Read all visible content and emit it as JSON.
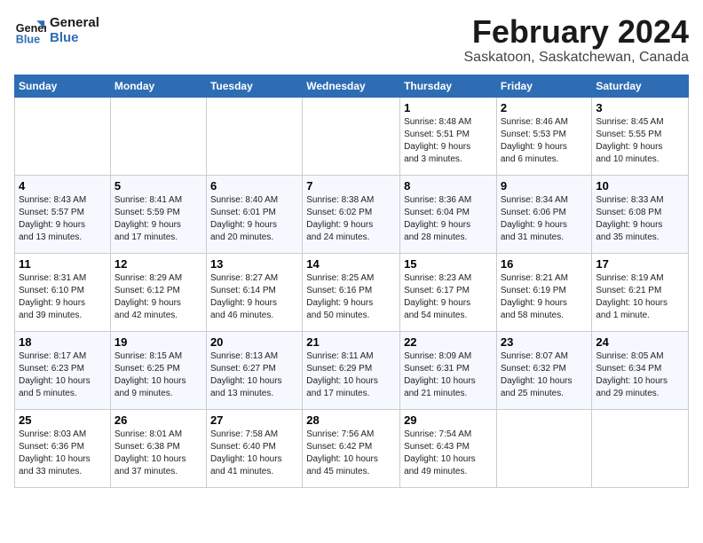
{
  "logo": {
    "line1": "General",
    "line2": "Blue"
  },
  "title": "February 2024",
  "location": "Saskatoon, Saskatchewan, Canada",
  "weekdays": [
    "Sunday",
    "Monday",
    "Tuesday",
    "Wednesday",
    "Thursday",
    "Friday",
    "Saturday"
  ],
  "weeks": [
    [
      {
        "day": "",
        "info": ""
      },
      {
        "day": "",
        "info": ""
      },
      {
        "day": "",
        "info": ""
      },
      {
        "day": "",
        "info": ""
      },
      {
        "day": "1",
        "info": "Sunrise: 8:48 AM\nSunset: 5:51 PM\nDaylight: 9 hours\nand 3 minutes."
      },
      {
        "day": "2",
        "info": "Sunrise: 8:46 AM\nSunset: 5:53 PM\nDaylight: 9 hours\nand 6 minutes."
      },
      {
        "day": "3",
        "info": "Sunrise: 8:45 AM\nSunset: 5:55 PM\nDaylight: 9 hours\nand 10 minutes."
      }
    ],
    [
      {
        "day": "4",
        "info": "Sunrise: 8:43 AM\nSunset: 5:57 PM\nDaylight: 9 hours\nand 13 minutes."
      },
      {
        "day": "5",
        "info": "Sunrise: 8:41 AM\nSunset: 5:59 PM\nDaylight: 9 hours\nand 17 minutes."
      },
      {
        "day": "6",
        "info": "Sunrise: 8:40 AM\nSunset: 6:01 PM\nDaylight: 9 hours\nand 20 minutes."
      },
      {
        "day": "7",
        "info": "Sunrise: 8:38 AM\nSunset: 6:02 PM\nDaylight: 9 hours\nand 24 minutes."
      },
      {
        "day": "8",
        "info": "Sunrise: 8:36 AM\nSunset: 6:04 PM\nDaylight: 9 hours\nand 28 minutes."
      },
      {
        "day": "9",
        "info": "Sunrise: 8:34 AM\nSunset: 6:06 PM\nDaylight: 9 hours\nand 31 minutes."
      },
      {
        "day": "10",
        "info": "Sunrise: 8:33 AM\nSunset: 6:08 PM\nDaylight: 9 hours\nand 35 minutes."
      }
    ],
    [
      {
        "day": "11",
        "info": "Sunrise: 8:31 AM\nSunset: 6:10 PM\nDaylight: 9 hours\nand 39 minutes."
      },
      {
        "day": "12",
        "info": "Sunrise: 8:29 AM\nSunset: 6:12 PM\nDaylight: 9 hours\nand 42 minutes."
      },
      {
        "day": "13",
        "info": "Sunrise: 8:27 AM\nSunset: 6:14 PM\nDaylight: 9 hours\nand 46 minutes."
      },
      {
        "day": "14",
        "info": "Sunrise: 8:25 AM\nSunset: 6:16 PM\nDaylight: 9 hours\nand 50 minutes."
      },
      {
        "day": "15",
        "info": "Sunrise: 8:23 AM\nSunset: 6:17 PM\nDaylight: 9 hours\nand 54 minutes."
      },
      {
        "day": "16",
        "info": "Sunrise: 8:21 AM\nSunset: 6:19 PM\nDaylight: 9 hours\nand 58 minutes."
      },
      {
        "day": "17",
        "info": "Sunrise: 8:19 AM\nSunset: 6:21 PM\nDaylight: 10 hours\nand 1 minute."
      }
    ],
    [
      {
        "day": "18",
        "info": "Sunrise: 8:17 AM\nSunset: 6:23 PM\nDaylight: 10 hours\nand 5 minutes."
      },
      {
        "day": "19",
        "info": "Sunrise: 8:15 AM\nSunset: 6:25 PM\nDaylight: 10 hours\nand 9 minutes."
      },
      {
        "day": "20",
        "info": "Sunrise: 8:13 AM\nSunset: 6:27 PM\nDaylight: 10 hours\nand 13 minutes."
      },
      {
        "day": "21",
        "info": "Sunrise: 8:11 AM\nSunset: 6:29 PM\nDaylight: 10 hours\nand 17 minutes."
      },
      {
        "day": "22",
        "info": "Sunrise: 8:09 AM\nSunset: 6:31 PM\nDaylight: 10 hours\nand 21 minutes."
      },
      {
        "day": "23",
        "info": "Sunrise: 8:07 AM\nSunset: 6:32 PM\nDaylight: 10 hours\nand 25 minutes."
      },
      {
        "day": "24",
        "info": "Sunrise: 8:05 AM\nSunset: 6:34 PM\nDaylight: 10 hours\nand 29 minutes."
      }
    ],
    [
      {
        "day": "25",
        "info": "Sunrise: 8:03 AM\nSunset: 6:36 PM\nDaylight: 10 hours\nand 33 minutes."
      },
      {
        "day": "26",
        "info": "Sunrise: 8:01 AM\nSunset: 6:38 PM\nDaylight: 10 hours\nand 37 minutes."
      },
      {
        "day": "27",
        "info": "Sunrise: 7:58 AM\nSunset: 6:40 PM\nDaylight: 10 hours\nand 41 minutes."
      },
      {
        "day": "28",
        "info": "Sunrise: 7:56 AM\nSunset: 6:42 PM\nDaylight: 10 hours\nand 45 minutes."
      },
      {
        "day": "29",
        "info": "Sunrise: 7:54 AM\nSunset: 6:43 PM\nDaylight: 10 hours\nand 49 minutes."
      },
      {
        "day": "",
        "info": ""
      },
      {
        "day": "",
        "info": ""
      }
    ]
  ]
}
